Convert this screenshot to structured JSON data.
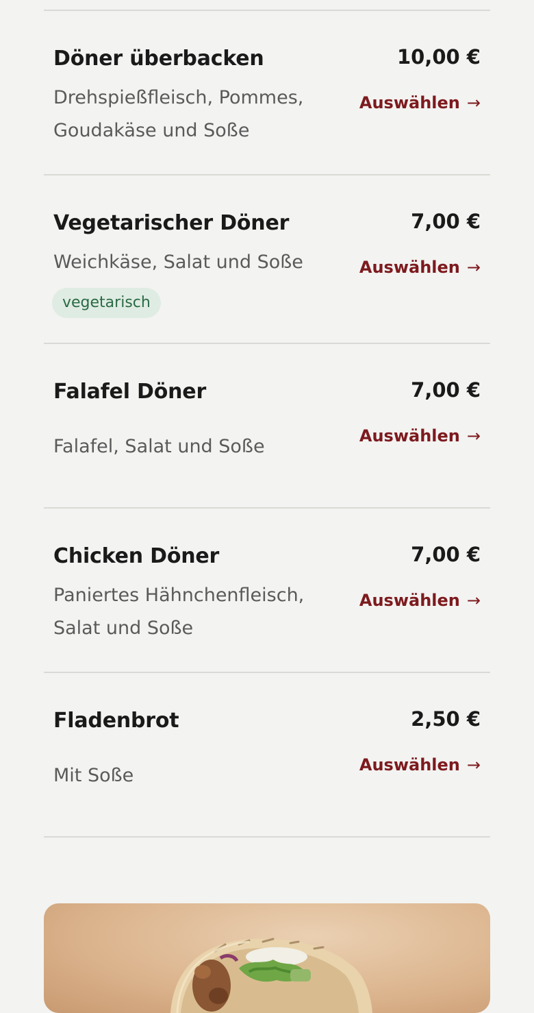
{
  "menu_items": [
    {
      "name": "Döner überbacken",
      "price": "10,00 €",
      "description": "Drehspießfleisch, Pommes, Goudakäse und Soße",
      "select_label": "Auswählen",
      "arrow": "→"
    },
    {
      "name": "Vegetarischer Döner",
      "price": "7,00 €",
      "description": "Weichkäse, Salat und Soße",
      "badge": "vegetarisch",
      "select_label": "Auswählen",
      "arrow": "→"
    },
    {
      "name": "Falafel Döner",
      "price": "7,00 €",
      "description": "Falafel, Salat und Soße",
      "select_label": "Auswählen",
      "arrow": "→"
    },
    {
      "name": "Chicken Döner",
      "price": "7,00 €",
      "description": "Paniertes Hähnchenfleisch, Salat und Soße",
      "select_label": "Auswählen",
      "arrow": "→"
    },
    {
      "name": "Fladenbrot",
      "price": "2,50 €",
      "description": "Mit Soße",
      "select_label": "Auswählen",
      "arrow": "→"
    }
  ],
  "colors": {
    "background": "#f3f3f1",
    "accent": "#7d1a1e",
    "badge_background": "#dfece3",
    "badge_text": "#2a6a44"
  }
}
